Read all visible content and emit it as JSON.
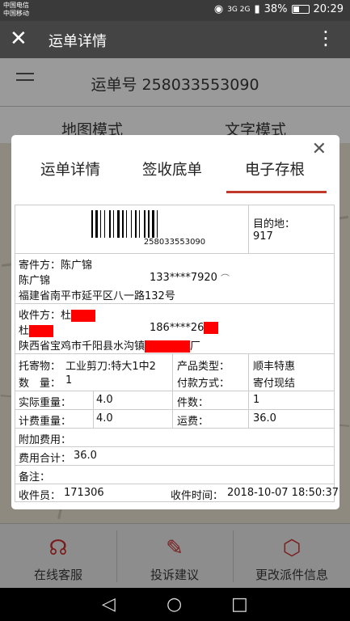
{
  "status": {
    "carrier1": "中国电信",
    "carrier2": "中国移动",
    "net": "3G 2G",
    "battery": "38%",
    "time": "20:29"
  },
  "appbar": {
    "close_icon": "close-icon",
    "title": "运单详情",
    "more_icon": "more-vertical-icon"
  },
  "underlying": {
    "waybill_no": "运单号 258033553090",
    "tab_map": "地图模式",
    "tab_text": "文字模式"
  },
  "bottom_actions": [
    {
      "label": "在线客服",
      "icon": "headset-icon"
    },
    {
      "label": "投诉建议",
      "icon": "edit-icon"
    },
    {
      "label": "更改派件信息",
      "icon": "package-icon"
    }
  ],
  "modal": {
    "tabs": [
      "运单详情",
      "签收底单",
      "电子存根"
    ],
    "active_tab": 2,
    "waybill": {
      "barcode_number": "258033553090",
      "destination_label": "目的地：",
      "destination_code": "917",
      "sender_label": "寄件方：陈广锦",
      "sender_name": "陈广锦",
      "sender_phone": "133****7920",
      "sender_address": "福建省南平市延平区八一路132号",
      "recipient_label": "收件方：杜",
      "recipient_name": "杜",
      "recipient_phone": "186****26",
      "recipient_address": "陕西省宝鸡市千阳县水沟镇",
      "recipient_address_suffix": "厂",
      "goods_label": "托寄物：",
      "goods_value": "工业剪刀:特大1中2",
      "qty_label": "数　量：",
      "qty_value": "1",
      "product_type_label": "产品类型：",
      "product_type_value": "顺丰特惠",
      "payment_label": "付款方式：",
      "payment_value": "寄付现结",
      "actual_weight_label": "实际重量：",
      "actual_weight_value": "4.0",
      "pieces_label": "件数：",
      "pieces_value": "1",
      "billed_weight_label": "计费重量：",
      "billed_weight_value": "4.0",
      "freight_label": "运费：",
      "freight_value": "36.0",
      "extra_fee_label": "附加费用：",
      "total_label": "费用合计：",
      "total_value": "36.0",
      "remark_label": "备注：",
      "courier_label": "收件员：",
      "courier_value": "171306",
      "pickup_time_label": "收件时间：",
      "pickup_time_value": "2018-10-07 18:50:37"
    }
  }
}
